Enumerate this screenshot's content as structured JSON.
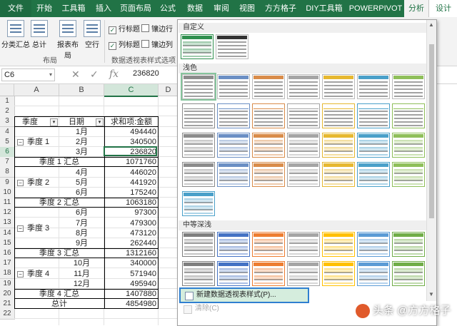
{
  "ribbon_tabs": [
    "文件",
    "开始",
    "工具箱",
    "插入",
    "页面布局",
    "公式",
    "数据",
    "审阅",
    "视图",
    "方方格子",
    "DIY工具箱",
    "POWERPIVOT",
    "分析",
    "设计"
  ],
  "ribbon": {
    "layout_buttons": [
      "分类汇总",
      "总计",
      "报表布局",
      "空行"
    ],
    "layout_group_label": "布局",
    "options": [
      {
        "label": "行标题",
        "checked": true
      },
      {
        "label": "镶边行",
        "checked": false
      },
      {
        "label": "列标题",
        "checked": true
      },
      {
        "label": "镶边列",
        "checked": false
      }
    ],
    "options_group_label": "数据透视表样式选项"
  },
  "formula_bar": {
    "name_box": "C6",
    "cancel": "✕",
    "enter": "✓",
    "fx": "fx",
    "value": "236820"
  },
  "grid": {
    "columns": [
      "A",
      "B",
      "C",
      "D"
    ],
    "rows": [
      "1",
      "2",
      "3",
      "4",
      "5",
      "6",
      "7",
      "8",
      "9",
      "10",
      "11",
      "12",
      "13",
      "14",
      "15",
      "16",
      "17",
      "18",
      "19",
      "20",
      "21",
      "22"
    ],
    "headers": {
      "quarter": "季度",
      "date": "日期",
      "sum": "求和项:金额"
    },
    "quarters": [
      {
        "label": "季度 1",
        "months": [
          "1月",
          "2月",
          "3月"
        ],
        "amounts": [
          "494440",
          "340500",
          "236820"
        ],
        "subtotal_label": "季度 1 汇总",
        "subtotal": "1071760"
      },
      {
        "label": "季度 2",
        "months": [
          "4月",
          "5月",
          "6月"
        ],
        "amounts": [
          "446020",
          "441920",
          "175240"
        ],
        "subtotal_label": "季度 2 汇总",
        "subtotal": "1063180"
      },
      {
        "label": "季度 3",
        "months": [
          "6月",
          "7月",
          "8月",
          "9月"
        ],
        "amounts": [
          "97300",
          "479300",
          "473120",
          "262440"
        ],
        "subtotal_label": "季度 3 汇总",
        "subtotal": "1312160"
      },
      {
        "label": "季度 4",
        "months": [
          "10月",
          "11月",
          "12月"
        ],
        "amounts": [
          "340000",
          "571940",
          "495940"
        ],
        "subtotal_label": "季度 4 汇总",
        "subtotal": "1407880"
      }
    ],
    "grand_total_label": "总计",
    "grand_total": "4854980"
  },
  "gallery": {
    "sections": [
      "自定义",
      "浅色",
      "中等深浅"
    ],
    "new_style": "新建数据透视表样式(P)...",
    "clear": "清除(C)",
    "light_colors": [
      "#8c8c8c",
      "#6b8fc4",
      "#d98c4a",
      "#a5a5a5",
      "#e6b830",
      "#4aa0c9",
      "#8fbf5a"
    ],
    "medium_colors": [
      "#7f7f7f",
      "#4472c4",
      "#ed7d31",
      "#a5a5a5",
      "#ffc000",
      "#5b9bd5",
      "#70ad47"
    ]
  },
  "watermark": "头条 @方方格子"
}
